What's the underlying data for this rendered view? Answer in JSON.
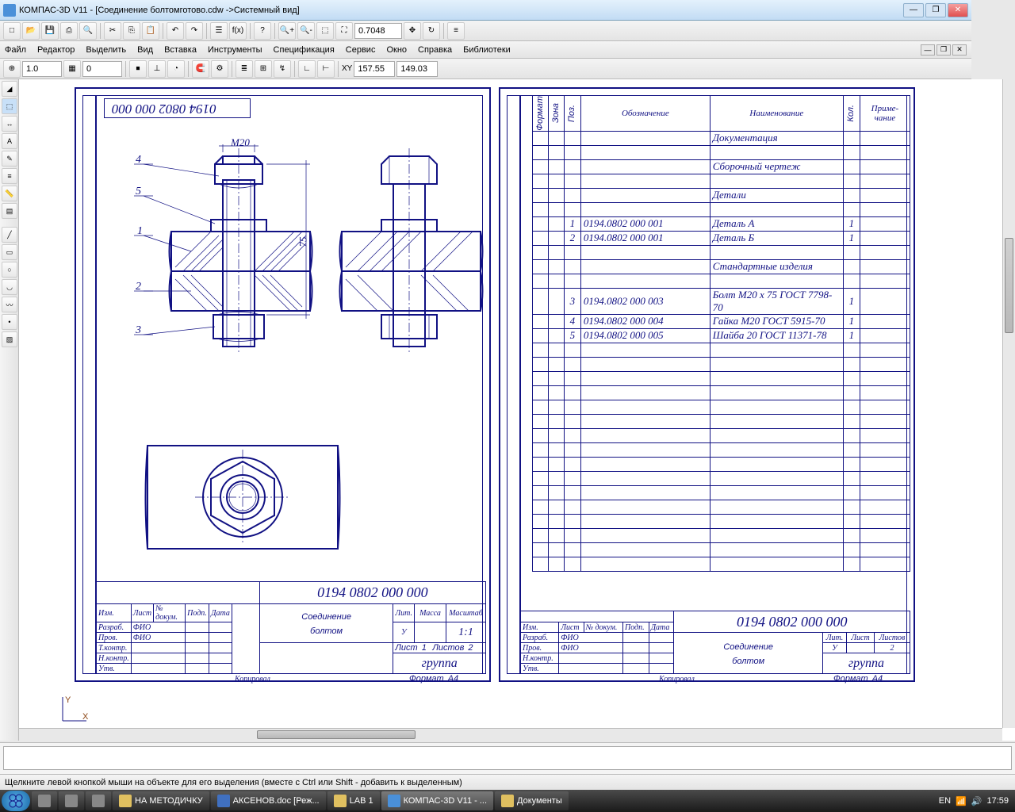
{
  "titlebar": {
    "text": "КОМПАС-3D V11 - [Соединение болтомготово.cdw ->Системный вид]"
  },
  "menubar": {
    "items": [
      "Файл",
      "Редактор",
      "Выделить",
      "Вид",
      "Вставка",
      "Инструменты",
      "Спецификация",
      "Сервис",
      "Окно",
      "Справка",
      "Библиотеки"
    ]
  },
  "toolbar1": {
    "zoom": "0.7048"
  },
  "toolbar3": {
    "v1": "1.0",
    "v2": "0",
    "coords_x": "157.55",
    "coords_y": "149.03"
  },
  "statusbar": {
    "text": "Щелкните левой кнопкой мыши на объекте для его выделения (вместе с Ctrl или Shift - добавить к выделенным)"
  },
  "taskbar": {
    "items": [
      "НА МЕТОДИЧКУ",
      "АКСЕНОВ.doc [Реж...",
      "LAB 1",
      "КОМПАС-3D V11 - ...",
      "Документы"
    ],
    "lang": "EN",
    "time": "17:59"
  },
  "drawing1": {
    "code_top": "0194 0802 000 000",
    "dim_m": "М20",
    "dim_h": "75",
    "pos": [
      "4",
      "5",
      "1",
      "2",
      "3"
    ],
    "stamp": {
      "code": "0194 0802 000 000",
      "title1": "Соединение",
      "title2": "болтом",
      "group": "группа",
      "scale": "1:1",
      "lbl_lit": "Лит.",
      "lbl_massa": "Масса",
      "lbl_masht": "Масштаб",
      "lbl_list": "Лист",
      "val_list": "1",
      "lbl_listov": "Листов",
      "val_listov": "2",
      "lbl_izm": "Изм.",
      "lbl_listn": "Лист",
      "lbl_ndok": "№ докум.",
      "lbl_podp": "Подп.",
      "lbl_data": "Дата",
      "lbl_razrab": "Разраб.",
      "lbl_prov": "Пров.",
      "lbl_tkontr": "Т.контр.",
      "lbl_nkontr": "Н.контр.",
      "lbl_utv": "Утв.",
      "fio": "ФИО",
      "lbl_kopiroval": "Копировал",
      "lbl_format": "Формат",
      "val_format": "А4"
    }
  },
  "drawing2": {
    "spec_head": {
      "format": "Формат",
      "zona": "Зона",
      "poz": "Поз.",
      "oboz": "Обозначение",
      "naim": "Наименование",
      "kol": "Кол.",
      "prim": "Приме-\nчание"
    },
    "rows": [
      {
        "poz": "",
        "oboz": "",
        "naim": "Документация",
        "kol": ""
      },
      {
        "poz": "",
        "oboz": "",
        "naim": "",
        "kol": ""
      },
      {
        "poz": "",
        "oboz": "",
        "naim": "Сборочный чертеж",
        "kol": ""
      },
      {
        "poz": "",
        "oboz": "",
        "naim": "",
        "kol": ""
      },
      {
        "poz": "",
        "oboz": "",
        "naim": "Детали",
        "kol": ""
      },
      {
        "poz": "",
        "oboz": "",
        "naim": "",
        "kol": ""
      },
      {
        "poz": "1",
        "oboz": "0194.0802 000 001",
        "naim": "Деталь А",
        "kol": "1"
      },
      {
        "poz": "2",
        "oboz": "0194.0802 000 001",
        "naim": "Деталь Б",
        "kol": "1"
      },
      {
        "poz": "",
        "oboz": "",
        "naim": "",
        "kol": ""
      },
      {
        "poz": "",
        "oboz": "",
        "naim": "Стандартные изделия",
        "kol": ""
      },
      {
        "poz": "",
        "oboz": "",
        "naim": "",
        "kol": ""
      },
      {
        "poz": "3",
        "oboz": "0194.0802 000 003",
        "naim": "Болт М20 х 75 ГОСТ 7798-70",
        "kol": "1"
      },
      {
        "poz": "4",
        "oboz": "0194.0802 000 004",
        "naim": "Гайка М20 ГОСТ 5915-70",
        "kol": "1"
      },
      {
        "poz": "5",
        "oboz": "0194.0802 000 005",
        "naim": "Шайба 20 ГОСТ 11371-78",
        "kol": "1"
      }
    ],
    "stamp": {
      "code": "0194 0802 000 000",
      "title1": "Соединение",
      "title2": "болтом",
      "group": "группа",
      "lbl_lit": "Лит.",
      "lbl_list": "Лист",
      "lbl_listov": "Листов",
      "val_listov": "2",
      "lbl_izm": "Изм.",
      "lbl_listn": "Лист",
      "lbl_ndok": "№ докум.",
      "lbl_podp": "Подп.",
      "lbl_data": "Дата",
      "lbl_razrab": "Разраб.",
      "lbl_prov": "Пров.",
      "lbl_nkontr": "Н.контр.",
      "lbl_utv": "Утв.",
      "fio": "ФИО",
      "lbl_kopiroval": "Копировал",
      "lbl_format": "Формат",
      "val_format": "А4"
    }
  }
}
